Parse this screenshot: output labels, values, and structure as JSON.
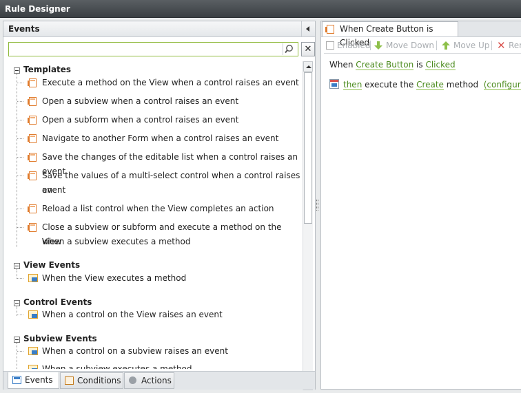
{
  "window": {
    "title": "Rule Designer"
  },
  "left_panel": {
    "title": "Events",
    "search": {
      "value": "",
      "placeholder": ""
    },
    "groups": [
      {
        "title": "Templates",
        "icon": "template-doc-icon",
        "items": [
          [
            "Execute a method on the View when a control raises an event"
          ],
          [
            "Open a subview when a control raises an event"
          ],
          [
            "Open a subform when a control raises an event"
          ],
          [
            "Navigate to another Form when a control raises an event"
          ],
          [
            "Save the changes of the editable list when a control raises an event"
          ],
          [
            "Save the values of a multi-select control when a control raises an",
            "event"
          ],
          [
            "Reload a list control when the View completes an action"
          ],
          [
            "Close a subview or subform and execute a method on the View",
            "when a subview executes a method"
          ]
        ]
      },
      {
        "title": "View Events",
        "icon": "view-event-icon",
        "items": [
          [
            "When the View executes a method"
          ]
        ]
      },
      {
        "title": "Control Events",
        "icon": "view-event-icon",
        "items": [
          [
            "When a control on the View raises an event"
          ]
        ]
      },
      {
        "title": "Subview Events",
        "icon": "view-event-icon",
        "items": [
          [
            "When a control on a subview raises an event"
          ],
          [
            "When a subview executes a method"
          ]
        ]
      }
    ],
    "bottom_tabs": [
      {
        "label": "Events",
        "icon": "events-icon",
        "active": true
      },
      {
        "label": "Conditions",
        "icon": "conditions-icon",
        "active": false
      },
      {
        "label": "Actions",
        "icon": "actions-icon",
        "active": false
      }
    ]
  },
  "right_panel": {
    "tab_label": "When Create Button is Clicked",
    "toolbar": {
      "enabled_label": "Enabled",
      "move_down_label": "Move Down",
      "move_up_label": "Move Up",
      "remove_label": "Rem"
    },
    "rule": {
      "line1": {
        "when": "When",
        "control": "Create Button",
        "is": "is",
        "event": "Clicked"
      },
      "line2": {
        "then": "then",
        "execute": "execute the",
        "method": "Create",
        "method_word": "method",
        "configure": "(configure)"
      }
    }
  },
  "colors": {
    "accent_green": "#8dc04a",
    "titlebar": "#3a3f43",
    "orange_icon": "#e07b2c"
  }
}
